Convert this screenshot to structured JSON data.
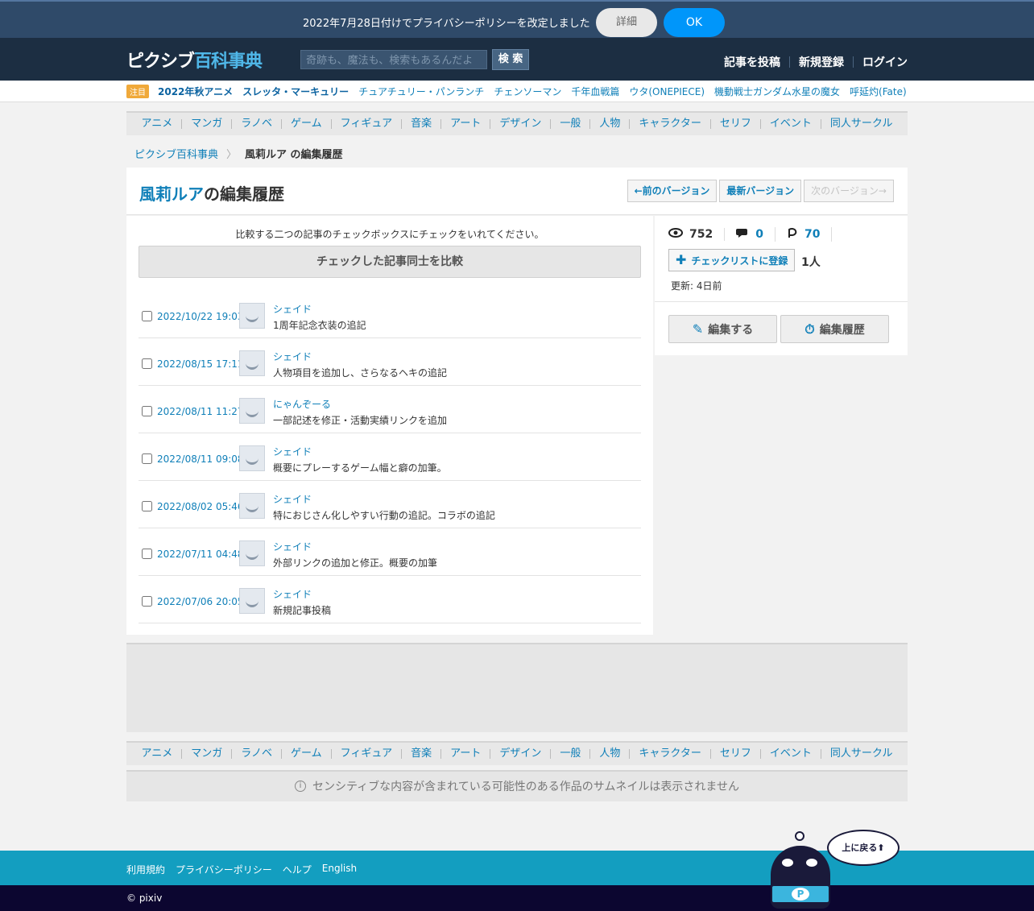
{
  "privacy": {
    "text": "2022年7月28日付けでプライバシーポリシーを改定しました",
    "detail_label": "詳細",
    "ok_label": "OK"
  },
  "header": {
    "logo_pix": "ピクシブ",
    "logo_enc": "百科事典",
    "search_placeholder": "奇跡も、魔法も、検索もあるんだよ",
    "search_label": "検 索",
    "links": [
      "記事を投稿",
      "新規登録",
      "ログイン"
    ]
  },
  "trending": {
    "badge": "注目",
    "items": [
      {
        "label": "2022年秋アニメ",
        "bold": true
      },
      {
        "label": "スレッタ・マーキュリー",
        "bold": true
      },
      {
        "label": "チュアチュリー・パンランチ",
        "bold": false
      },
      {
        "label": "チェンソーマン",
        "bold": false
      },
      {
        "label": "千年血戦篇",
        "bold": false
      },
      {
        "label": "ウタ(ONEPIECE)",
        "bold": false
      },
      {
        "label": "機動戦士ガンダム水星の魔女",
        "bold": false
      },
      {
        "label": "呼延灼(Fate)",
        "bold": false
      }
    ]
  },
  "categories": [
    "アニメ",
    "マンガ",
    "ラノベ",
    "ゲーム",
    "フィギュア",
    "音楽",
    "アート",
    "デザイン",
    "一般",
    "人物",
    "キャラクター",
    "セリフ",
    "イベント",
    "同人サークル"
  ],
  "breadcrumb": {
    "home": "ピクシブ百科事典",
    "current": "風莉ルア の編集履歴"
  },
  "title": {
    "name": "風莉ルア",
    "suffix": "の編集履歴",
    "prev_label": "←前のバージョン",
    "latest_label": "最新バージョン",
    "next_label": "次のバージョン→"
  },
  "main": {
    "instruction": "比較する二つの記事のチェックボックスにチェックをいれてください。",
    "compare_label": "チェックした記事同士を比較",
    "revisions": [
      {
        "date": "2022/10/22 19:03",
        "user": "シェイド",
        "message": "1周年記念衣装の追記"
      },
      {
        "date": "2022/08/15 17:11",
        "user": "シェイド",
        "message": "人物項目を追加し、さらなるヘキの追記"
      },
      {
        "date": "2022/08/11 11:27",
        "user": "にゃんぞーる",
        "message": "一部記述を修正・活動実績リンクを追加"
      },
      {
        "date": "2022/08/11 09:08",
        "user": "シェイド",
        "message": "概要にプレーするゲーム幅と癖の加筆。"
      },
      {
        "date": "2022/08/02 05:46",
        "user": "シェイド",
        "message": "特におじさん化しやすい行動の追記。コラボの追記"
      },
      {
        "date": "2022/07/11 04:48",
        "user": "シェイド",
        "message": "外部リンクの追加と修正。概要の加筆"
      },
      {
        "date": "2022/07/06 20:05",
        "user": "シェイド",
        "message": "新規記事投稿"
      }
    ]
  },
  "sidebar": {
    "views": "752",
    "comments": "0",
    "pixiv_count": "70",
    "checklist_label": "チェックリストに登録",
    "checklist_count": "1人",
    "updated_label": "更新:",
    "updated_value": "4日前",
    "edit_label": "編集する",
    "history_label": "編集履歴"
  },
  "sensitive_notice": "センシティブな内容が含まれている可能性のある作品のサムネイルは表示されません",
  "footer": {
    "links": [
      "利用規約",
      "プライバシーポリシー",
      "ヘルプ",
      "English"
    ],
    "copyright": "© pixiv"
  },
  "to_top_label": "上に戻る⬆"
}
